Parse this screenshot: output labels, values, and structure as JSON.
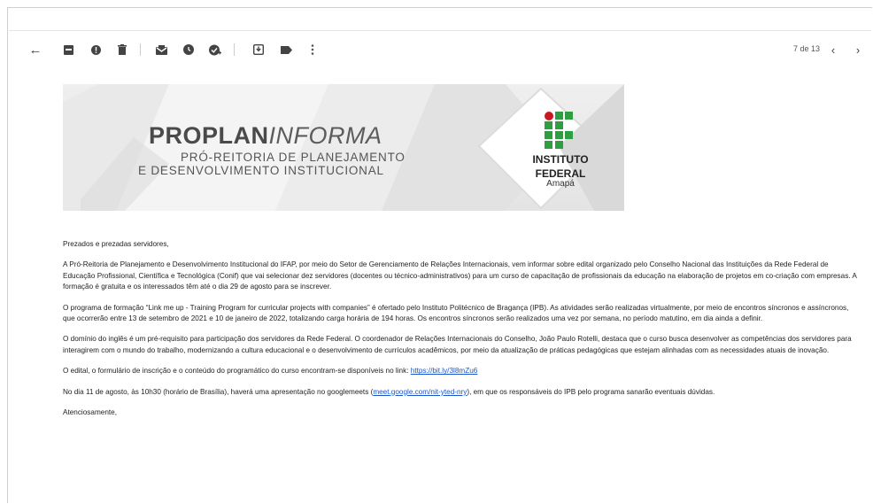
{
  "toolbar": {
    "back_label": "←",
    "pager_text": "7 de 13",
    "prev_label": "‹",
    "next_label": "›",
    "icons": [
      "back-arrow-icon",
      "archive-icon",
      "report-spam-icon",
      "delete-icon",
      "mark-unread-icon",
      "snooze-icon",
      "add-task-icon",
      "move-to-icon",
      "label-icon",
      "more-options-icon"
    ]
  },
  "banner": {
    "title_bold": "PROPLAN",
    "title_italic": "INFORMA",
    "subtitle_line1": "PRÓ-REITORIA DE PLANEJAMENTO",
    "subtitle_line2": "E DESENVOLVIMENTO INSTITUCIONAL",
    "logo_line1": "INSTITUTO",
    "logo_line2": "FEDERAL",
    "logo_line3": "Amapá",
    "logo_green": "#2f9e41",
    "logo_red": "#c8191e"
  },
  "email": {
    "greeting": "Prezados e prezadas servidores,",
    "p1": "A Pró-Reitoria  de Planejamento e Desenvolvimento Institucional  do IFAP, por meio do Setor de Gerenciamento de Relações  Internacionais, vem informar sobre edital organizado pelo Conselho Nacional das Instituições da Rede Federal de Educação Profissional, Científica e Tecnológica (Conif) que vai selecionar dez servidores (docentes ou técnico-administrativos) para um curso de capacitação de profissionais da educação na elaboração de projetos em co-criação com empresas. A formação é gratuita e os interessados têm até o dia 29 de agosto para se inscrever.",
    "p2": "O programa de formação “Link me up - Training Program for curricular projects with companies” é ofertado pelo Instituto Politécnico de Bragança (IPB). As atividades serão realizadas virtualmente, por meio de encontros síncronos e assíncronos, que ocorrerão entre 13 de setembro de 2021 e 10 de janeiro de 2022, totalizando carga horária de 194 horas. Os encontros síncronos serão realizados uma vez por semana, no período matutino, em dia ainda a definir.",
    "p3": "O domínio do inglês é um pré-requisito para participação dos servidores da Rede Federal. O coordenador de Relações Internacionais do Conselho, João Paulo Rotelli, destaca que o curso busca desenvolver as competências dos servidores para interagirem com o mundo do trabalho, modernizando a cultura educacional e o desenvolvimento de currículos acadêmicos, por meio da atualização de práticas pedagógicas que estejam alinhadas com as necessidades atuais de inovação.",
    "p4_text": "O edital, o formulário de inscrição e o conteúdo do programático do curso encontram-se disponíveis no link: ",
    "p4_link": "https://bit.ly/3l8mZu6",
    "p5_before": "No dia 11 de agosto, às 10h30 (horário de Brasília), haverá uma apresentação no googlemeets (",
    "p5_link": "meet.google.com/nit-yted-nry",
    "p5_after": "), em que os responsáveis do IPB pelo programa sanarão eventuais dúvidas.",
    "closing": "Atenciosamente,"
  }
}
